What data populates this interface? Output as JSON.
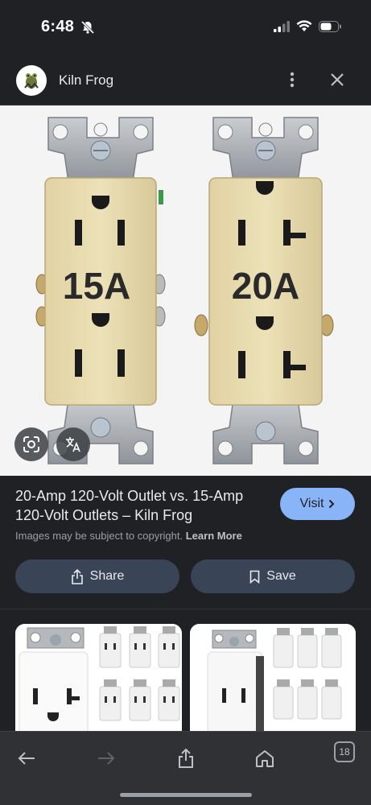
{
  "status": {
    "time": "6:48"
  },
  "header": {
    "site_name": "Kiln Frog"
  },
  "image": {
    "left_outlet_label": "15A",
    "right_outlet_label": "20A"
  },
  "info": {
    "title": "20-Amp 120-Volt Outlet vs. 15-Amp 120-Volt Outlets – Kiln Frog",
    "visit_label": "Visit",
    "copyright_text": "Images may be subject to copyright.",
    "learn_more": "Learn More",
    "share_label": "Share",
    "save_label": "Save"
  },
  "bottom": {
    "tab_count": "18"
  },
  "colors": {
    "accent": "#8ab4f8",
    "background": "#202124",
    "button": "#394457",
    "outlet_face": "#e8dcb0"
  },
  "icons": [
    "bell-off-icon",
    "signal-icon",
    "wifi-icon",
    "battery-icon",
    "more-vert-icon",
    "close-icon",
    "lens-icon",
    "translate-icon",
    "chevron-right-icon",
    "share-icon",
    "bookmark-icon",
    "back-icon",
    "forward-icon",
    "home-icon"
  ]
}
